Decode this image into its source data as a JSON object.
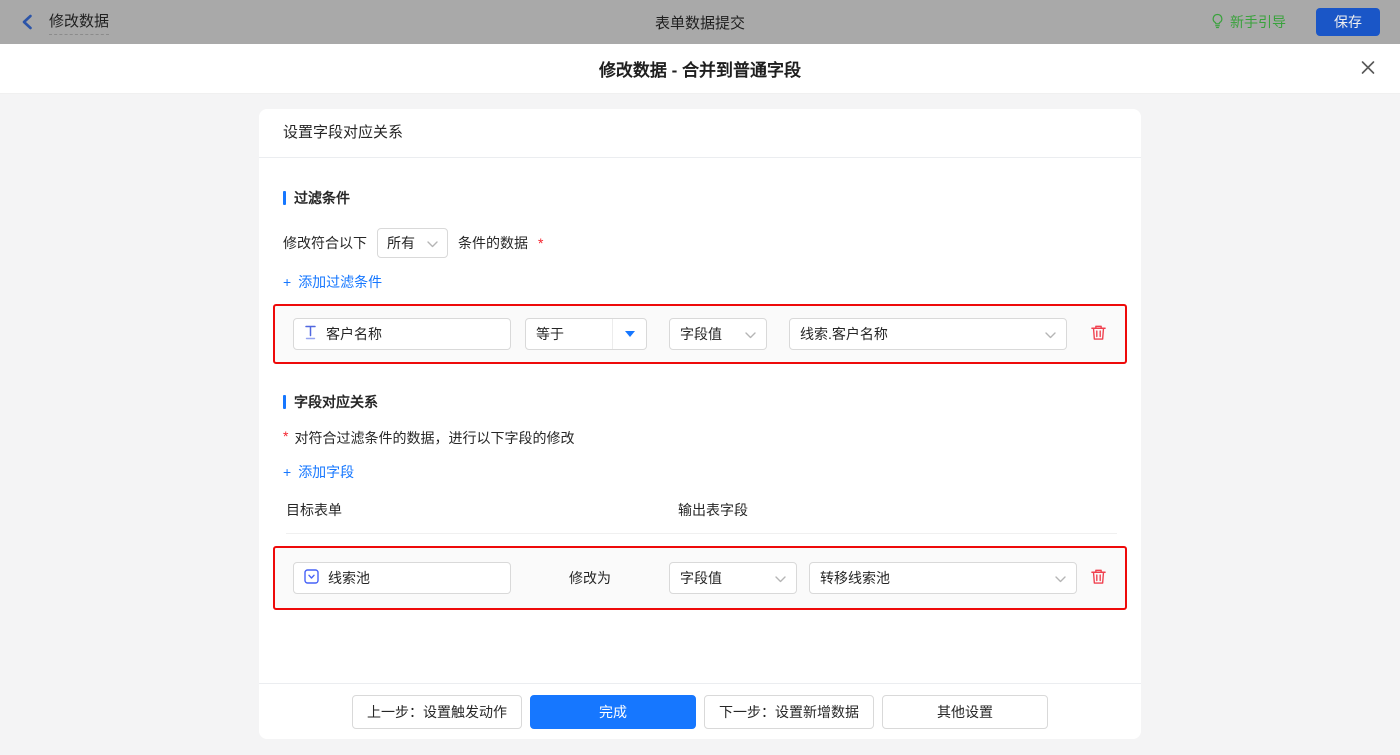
{
  "topbar": {
    "back": "修改数据",
    "title": "表单数据提交",
    "guide": "新手引导",
    "save": "保存"
  },
  "modal": {
    "title": "修改数据 - 合并到普通字段"
  },
  "panel": {
    "header": "设置字段对应关系",
    "filter": {
      "title": "过滤条件",
      "match_prefix": "修改符合以下",
      "match_value": "所有",
      "match_suffix": "条件的数据",
      "required": "*",
      "add_icon": "+",
      "add_label": "添加过滤条件",
      "row": {
        "field": "客户名称",
        "operator": "等于",
        "value_type": "字段值",
        "value_source": "线索.客户名称"
      }
    },
    "mapping": {
      "title": "字段对应关系",
      "required": "*",
      "hint": "对符合过滤条件的数据，进行以下字段的修改",
      "add_icon": "+",
      "add_label": "添加字段",
      "columns": {
        "target": "目标表单",
        "output": "输出表字段"
      },
      "row": {
        "field": "线索池",
        "action": "修改为",
        "value_type": "字段值",
        "output": "转移线索池"
      }
    },
    "footer": {
      "prev": "上一步：设置触发动作",
      "done": "完成",
      "next": "下一步：设置新增数据",
      "other": "其他设置"
    }
  },
  "colors": {
    "accent_blue": "#1677ff",
    "highlight_red": "#ee0a0a",
    "trash_red": "#f0414f",
    "guide_green": "#39a23c",
    "save_blue": "#1a56c7",
    "topbar_gray": "#a9a9a9",
    "required_red": "#f5222d"
  }
}
